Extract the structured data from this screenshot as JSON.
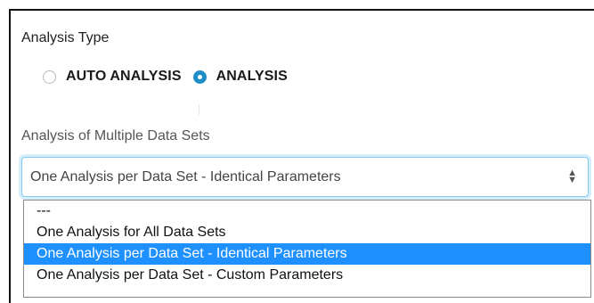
{
  "analysis_type": {
    "title": "Analysis Type",
    "options": [
      {
        "label": "AUTO ANALYSIS",
        "selected": false
      },
      {
        "label": "ANALYSIS",
        "selected": true
      }
    ]
  },
  "multiple_data_sets": {
    "title": "Analysis of Multiple Data Sets",
    "selected_value": "One Analysis per Data Set - Identical Parameters",
    "caret_icon": "updown-caret-icon",
    "options": [
      "---",
      "One Analysis for All Data Sets",
      "One Analysis per Data Set - Identical Parameters",
      "One Analysis per Data Set - Custom Parameters"
    ],
    "highlighted_index": 2
  },
  "colors": {
    "radio_active": "#1f8ec7",
    "focus_border": "#86c9ef",
    "highlight": "#1e90ff"
  }
}
